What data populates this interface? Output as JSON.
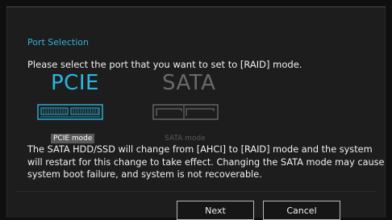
{
  "dialog": {
    "section_title": "Port Selection",
    "prompt": "Please select the port that you want to set to [RAID] mode.",
    "options": [
      {
        "id": "pcie",
        "big_label": "PCIE",
        "mode_label": "PCIE mode",
        "selected": true,
        "icon": "pcie-slot-icon"
      },
      {
        "id": "sata",
        "big_label": "SATA",
        "mode_label": "SATA mode",
        "selected": false,
        "icon": "sata-port-icon"
      }
    ],
    "warning": "The SATA HDD/SSD will change from [AHCI] to [RAID] mode and the system will restart for this change to take effect. Changing the SATA mode may cause system boot failure, and system is not recoverable.",
    "buttons": {
      "next": "Next",
      "cancel": "Cancel"
    }
  },
  "colors": {
    "accent": "#29b7e0",
    "disabled": "#6a6a6a",
    "background": "#1d1d1d"
  }
}
